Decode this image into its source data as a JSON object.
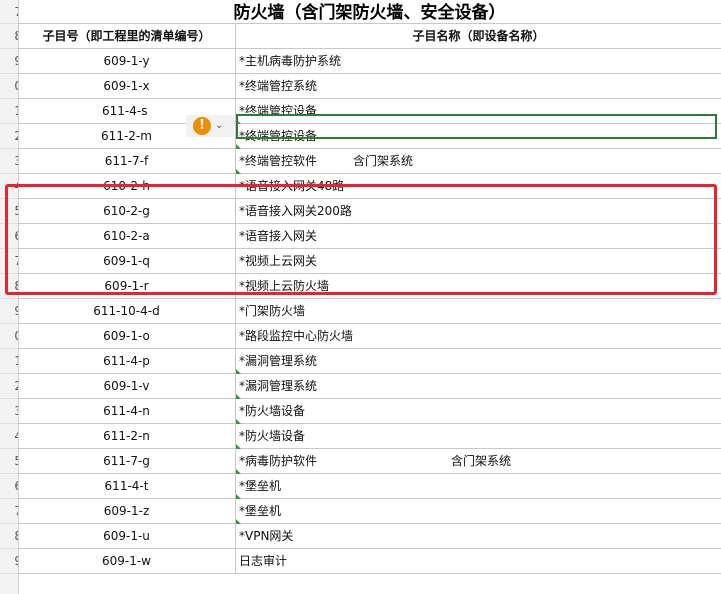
{
  "row_numbers": [
    "7",
    "8",
    "9",
    "0",
    "1",
    "2",
    "3",
    "4",
    "5",
    "6",
    "7",
    "8",
    "9",
    "0",
    "1",
    "2",
    "3",
    "4",
    "5",
    "6",
    "7",
    "8",
    "9"
  ],
  "title": "防火墙（含门架防火墙、安全设备）",
  "header": {
    "col1": "子目号（即工程里的清单编号）",
    "col2": "子目名称（即设备名称）"
  },
  "rows": [
    {
      "code": "609-1-y",
      "name": "*主机病毒防护系统",
      "extra": ""
    },
    {
      "code": "609-1-x",
      "name": "*终端管控系统",
      "extra": ""
    },
    {
      "code": "611-4-s",
      "name": "*终端管控设备",
      "extra": ""
    },
    {
      "code": "611-2-m",
      "name": "*终端管控设备",
      "extra": ""
    },
    {
      "code": "611-7-f",
      "name": "*终端管控软件",
      "extra": "含门架系统"
    },
    {
      "code": "610-2-h",
      "name": "*语音接入网关48路",
      "extra": ""
    },
    {
      "code": "610-2-g",
      "name": "*语音接入网关200路",
      "extra": ""
    },
    {
      "code": "610-2-a",
      "name": "*语音接入网关",
      "extra": ""
    },
    {
      "code": "609-1-q",
      "name": "*视频上云网关",
      "extra": ""
    },
    {
      "code": "609-1-r",
      "name": "*视频上云防火墙",
      "extra": ""
    },
    {
      "code": "611-10-4-d",
      "name": "*门架防火墙",
      "extra": ""
    },
    {
      "code": "609-1-o",
      "name": "*路段监控中心防火墙",
      "extra": ""
    },
    {
      "code": "611-4-p",
      "name": "*漏洞管理系统",
      "extra": ""
    },
    {
      "code": "609-1-v",
      "name": "*漏洞管理系统",
      "extra": ""
    },
    {
      "code": "611-4-n",
      "name": "*防火墙设备",
      "extra": ""
    },
    {
      "code": "611-2-n",
      "name": "*防火墙设备",
      "extra": ""
    },
    {
      "code": "611-7-g",
      "name": "*病毒防护软件",
      "extra": "含门架系统"
    },
    {
      "code": "611-4-t",
      "name": "*堡垒机",
      "extra": ""
    },
    {
      "code": "609-1-z",
      "name": "*堡垒机",
      "extra": ""
    },
    {
      "code": "609-1-u",
      "name": "*VPN网关",
      "extra": ""
    },
    {
      "code": "609-1-w",
      "name": "日志审计",
      "extra": ""
    }
  ],
  "warning_icon": "exclamation-circle-icon",
  "colors": {
    "selection": "#2e7d32",
    "highlight_box": "#e8262a",
    "warning": "#f08c00"
  }
}
